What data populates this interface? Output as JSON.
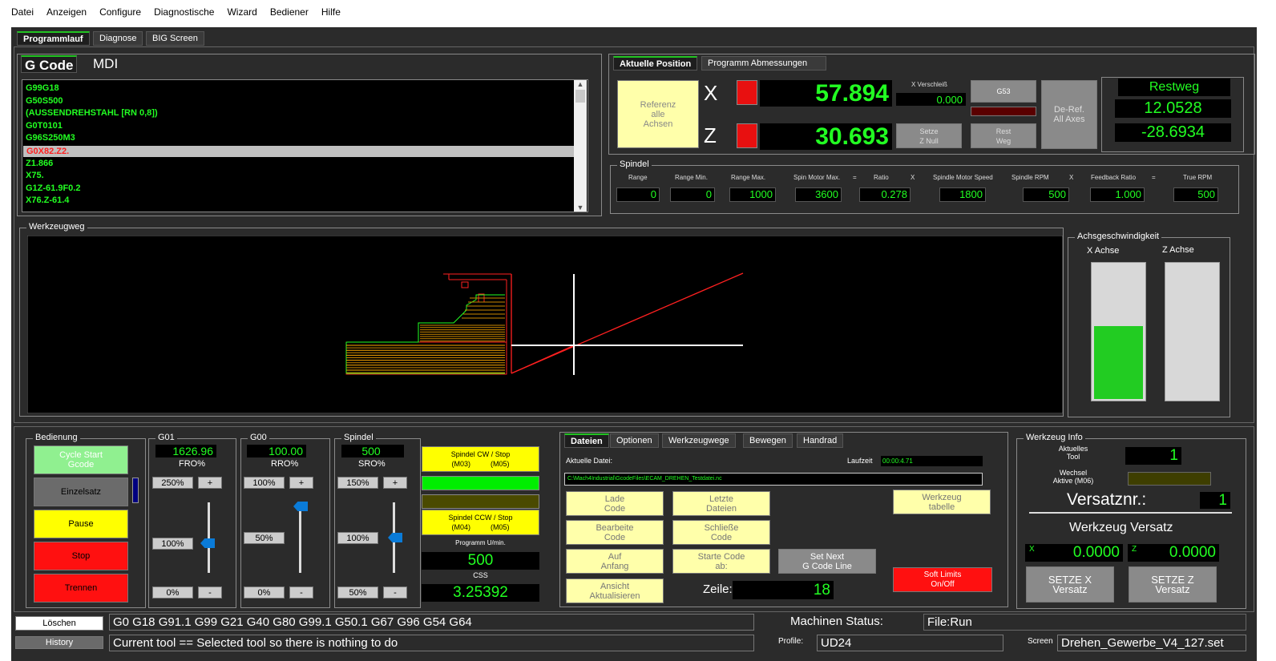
{
  "menu": [
    "Datei",
    "Anzeigen",
    "Configure",
    "Diagnostische",
    "Wizard",
    "Bediener",
    "Hilfe"
  ],
  "main_tabs": [
    "Programmlauf",
    "Diagnose",
    "BIG Screen"
  ],
  "code_tabs": [
    "G Code",
    "MDI"
  ],
  "gcode_lines": [
    "G99G18",
    "G50S500",
    "(AUSSENDREHSTAHL [RN 0,8])",
    "G0T0101",
    "G96S250M3",
    "G0X82.Z2.",
    "Z1.866",
    "X75.",
    "G1Z-61.9F0.2",
    "X76.Z-61.4"
  ],
  "gcode_selected": 5,
  "position_tabs": [
    "Aktuelle Position",
    "Programm Abmessungen"
  ],
  "referenz_btn": "Referenz\nalle\nAchsen",
  "axis_x": "X",
  "axis_z": "Z",
  "x_value": "57.894",
  "z_value": "30.693",
  "x_verschleiss_label": "X Verschleiß",
  "x_verschleiss_value": "0.000",
  "g53_btn": "G53",
  "setze_znull_btn": "Setze\nZ Null",
  "rest_weg_btn": "Rest\nWeg",
  "deref_btn": "De-Ref.\nAll Axes",
  "restweg_label": "Restweg",
  "restweg_x": "12.0528",
  "restweg_z": "-28.6934",
  "spindel_group": "Spindel",
  "spindel_labels": [
    "Range",
    "Range Min.",
    "Range Max.",
    "Spin Motor Max.",
    "=",
    "Ratio",
    "X",
    "Spindle Motor Speed",
    "Spindle RPM",
    "X",
    "Feedback Ratio",
    "=",
    "True RPM"
  ],
  "spindel_values": [
    "0",
    "0",
    "1000",
    "3600",
    "0.278",
    "1800",
    "500",
    "1.000",
    "500"
  ],
  "werkzeugweg_label": "Werkzeugweg",
  "achsgeschw_label": "Achsgeschwindigkeit",
  "x_achse_label": "X Achse",
  "z_achse_label": "Z Achse",
  "x_achse_level": 0.54,
  "z_achse_level": 0.0,
  "bedienung_label": "Bedienung",
  "cycle_start_btn": "Cycle Start\nGcode",
  "einzelsatz_btn": "Einzelsatz",
  "pause_btn": "Pause",
  "stop_btn": "Stop",
  "trennen_btn": "Trennen",
  "g01": {
    "title": "G01",
    "value": "1626.96",
    "label": "FRO%",
    "top": "250%",
    "mid": "100%",
    "bot": "0%"
  },
  "g00": {
    "title": "G00",
    "value": "100.00",
    "label": "RRO%",
    "top": "100%",
    "mid": "50%",
    "bot": "0%"
  },
  "spindel_sro": {
    "title": "Spindel",
    "value": "500",
    "label": "SRO%",
    "top": "150%",
    "mid": "100%",
    "bot": "50%"
  },
  "plus": "+",
  "minus": "-",
  "spindel_cw_btn": "Spindel CW / Stop\n(M03)          (M05)",
  "spindel_ccw_btn": "Spindel CCW / Stop\n(M04)          (M05)",
  "programm_umin_label": "Programm U/min.",
  "programm_umin_value": "500",
  "css_label": "CSS",
  "css_value": "3.25392",
  "file_tabs": [
    "Dateien",
    "Optionen",
    "Werkzeugwege",
    "Bewegen",
    "Handrad"
  ],
  "aktuelle_datei_label": "Aktuelle Datei:",
  "laufzeit_label": "Laufzeit",
  "laufzeit_value": "00:00:4.71",
  "datei_path": "C:\\Mach4Industrial\\GcodeFiles\\ECAM_DREHEN_Testdatei.nc",
  "lade_code_btn": "Lade\nCode",
  "letzte_dateien_btn": "Letzte\nDateien",
  "werkzeug_tabelle_btn": "Werkzeug\ntabelle",
  "bearbeite_code_btn": "Bearbeite\nCode",
  "schliesse_code_btn": "Schließe\nCode",
  "auf_anfang_btn": "Auf\nAnfang",
  "starte_code_btn": "Starte Code\nab:",
  "set_next_btn": "Set Next\nG Code Line",
  "ansicht_btn": "Ansicht\nAktualisieren",
  "zeile_label": "Zeile:",
  "zeile_value": "18",
  "soft_limits_btn": "Soft Limits\nOn/Off",
  "werkzeug_info_label": "Werkzeug Info",
  "aktuelles_tool_label": "Aktuelles\nTool",
  "aktuelles_tool_value": "1",
  "wechsel_label": "Wechsel\nAktive (M06)",
  "versatznr_label": "Versatznr.:",
  "versatznr_value": "1",
  "werkzeug_versatz_label": "Werkzeug Versatz",
  "versatz_x_letter": "X",
  "versatz_x_value": "0.0000",
  "versatz_z_letter": "Z",
  "versatz_z_value": "0.0000",
  "setze_x_btn": "SETZE X\nVersatz",
  "setze_z_btn": "SETZE Z\nVersatz",
  "loeschen_btn": "Löschen",
  "history_btn": "History",
  "modal_codes": "G0 G18 G91.1 G99 G21 G40 G80 G99.1 G50.1 G67 G96 G54 G64",
  "message": "Current tool == Selected tool so there is nothing to do",
  "maschinen_status_label": "Machinen Status:",
  "maschinen_status_value": "File:Run",
  "profile_label": "Profile:",
  "profile_value": "UD24",
  "screen_label": "Screen",
  "screen_value": "Drehen_Gewerbe_V4_127.set"
}
